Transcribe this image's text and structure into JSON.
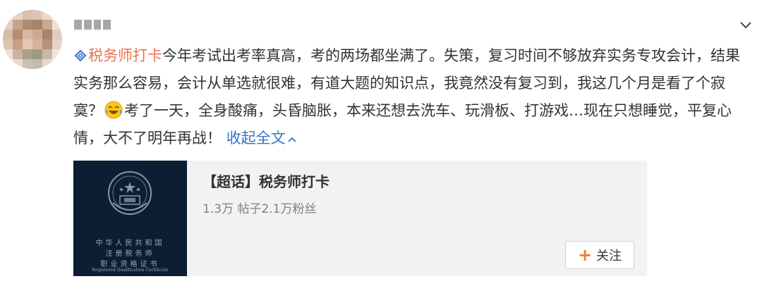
{
  "post": {
    "topic": "税务师打卡",
    "text_part1": "今年考试出考率真高，考的两场都坐满了。失策，复习时间不够放弃实务专攻会计，结果实务那么容易，会计从单选就很难，有道大题的知识点，我竟然没有复习到，我这几个月是看了个寂寞？",
    "text_part2": "考了一天，全身酸痛，头昏脑胀，本来还想去洗车、玩滑板、打游戏…现在只想睡觉，平复心情，大不了明年再战！",
    "collapse_label": "收起全文"
  },
  "card": {
    "title": "【超话】税务师打卡",
    "stats": "1.3万 帖子2.1万粉丝",
    "follow_label": "关注",
    "certificate_lines": [
      "中华人民共和国",
      "注册税务师",
      "职业资格证书",
      "Registered Qualification Certificate"
    ]
  },
  "colors": {
    "topic": "#eb7350",
    "link": "#3574c4",
    "certificate_bg": "#0d1e33",
    "follow_plus": "#f07c2a"
  }
}
